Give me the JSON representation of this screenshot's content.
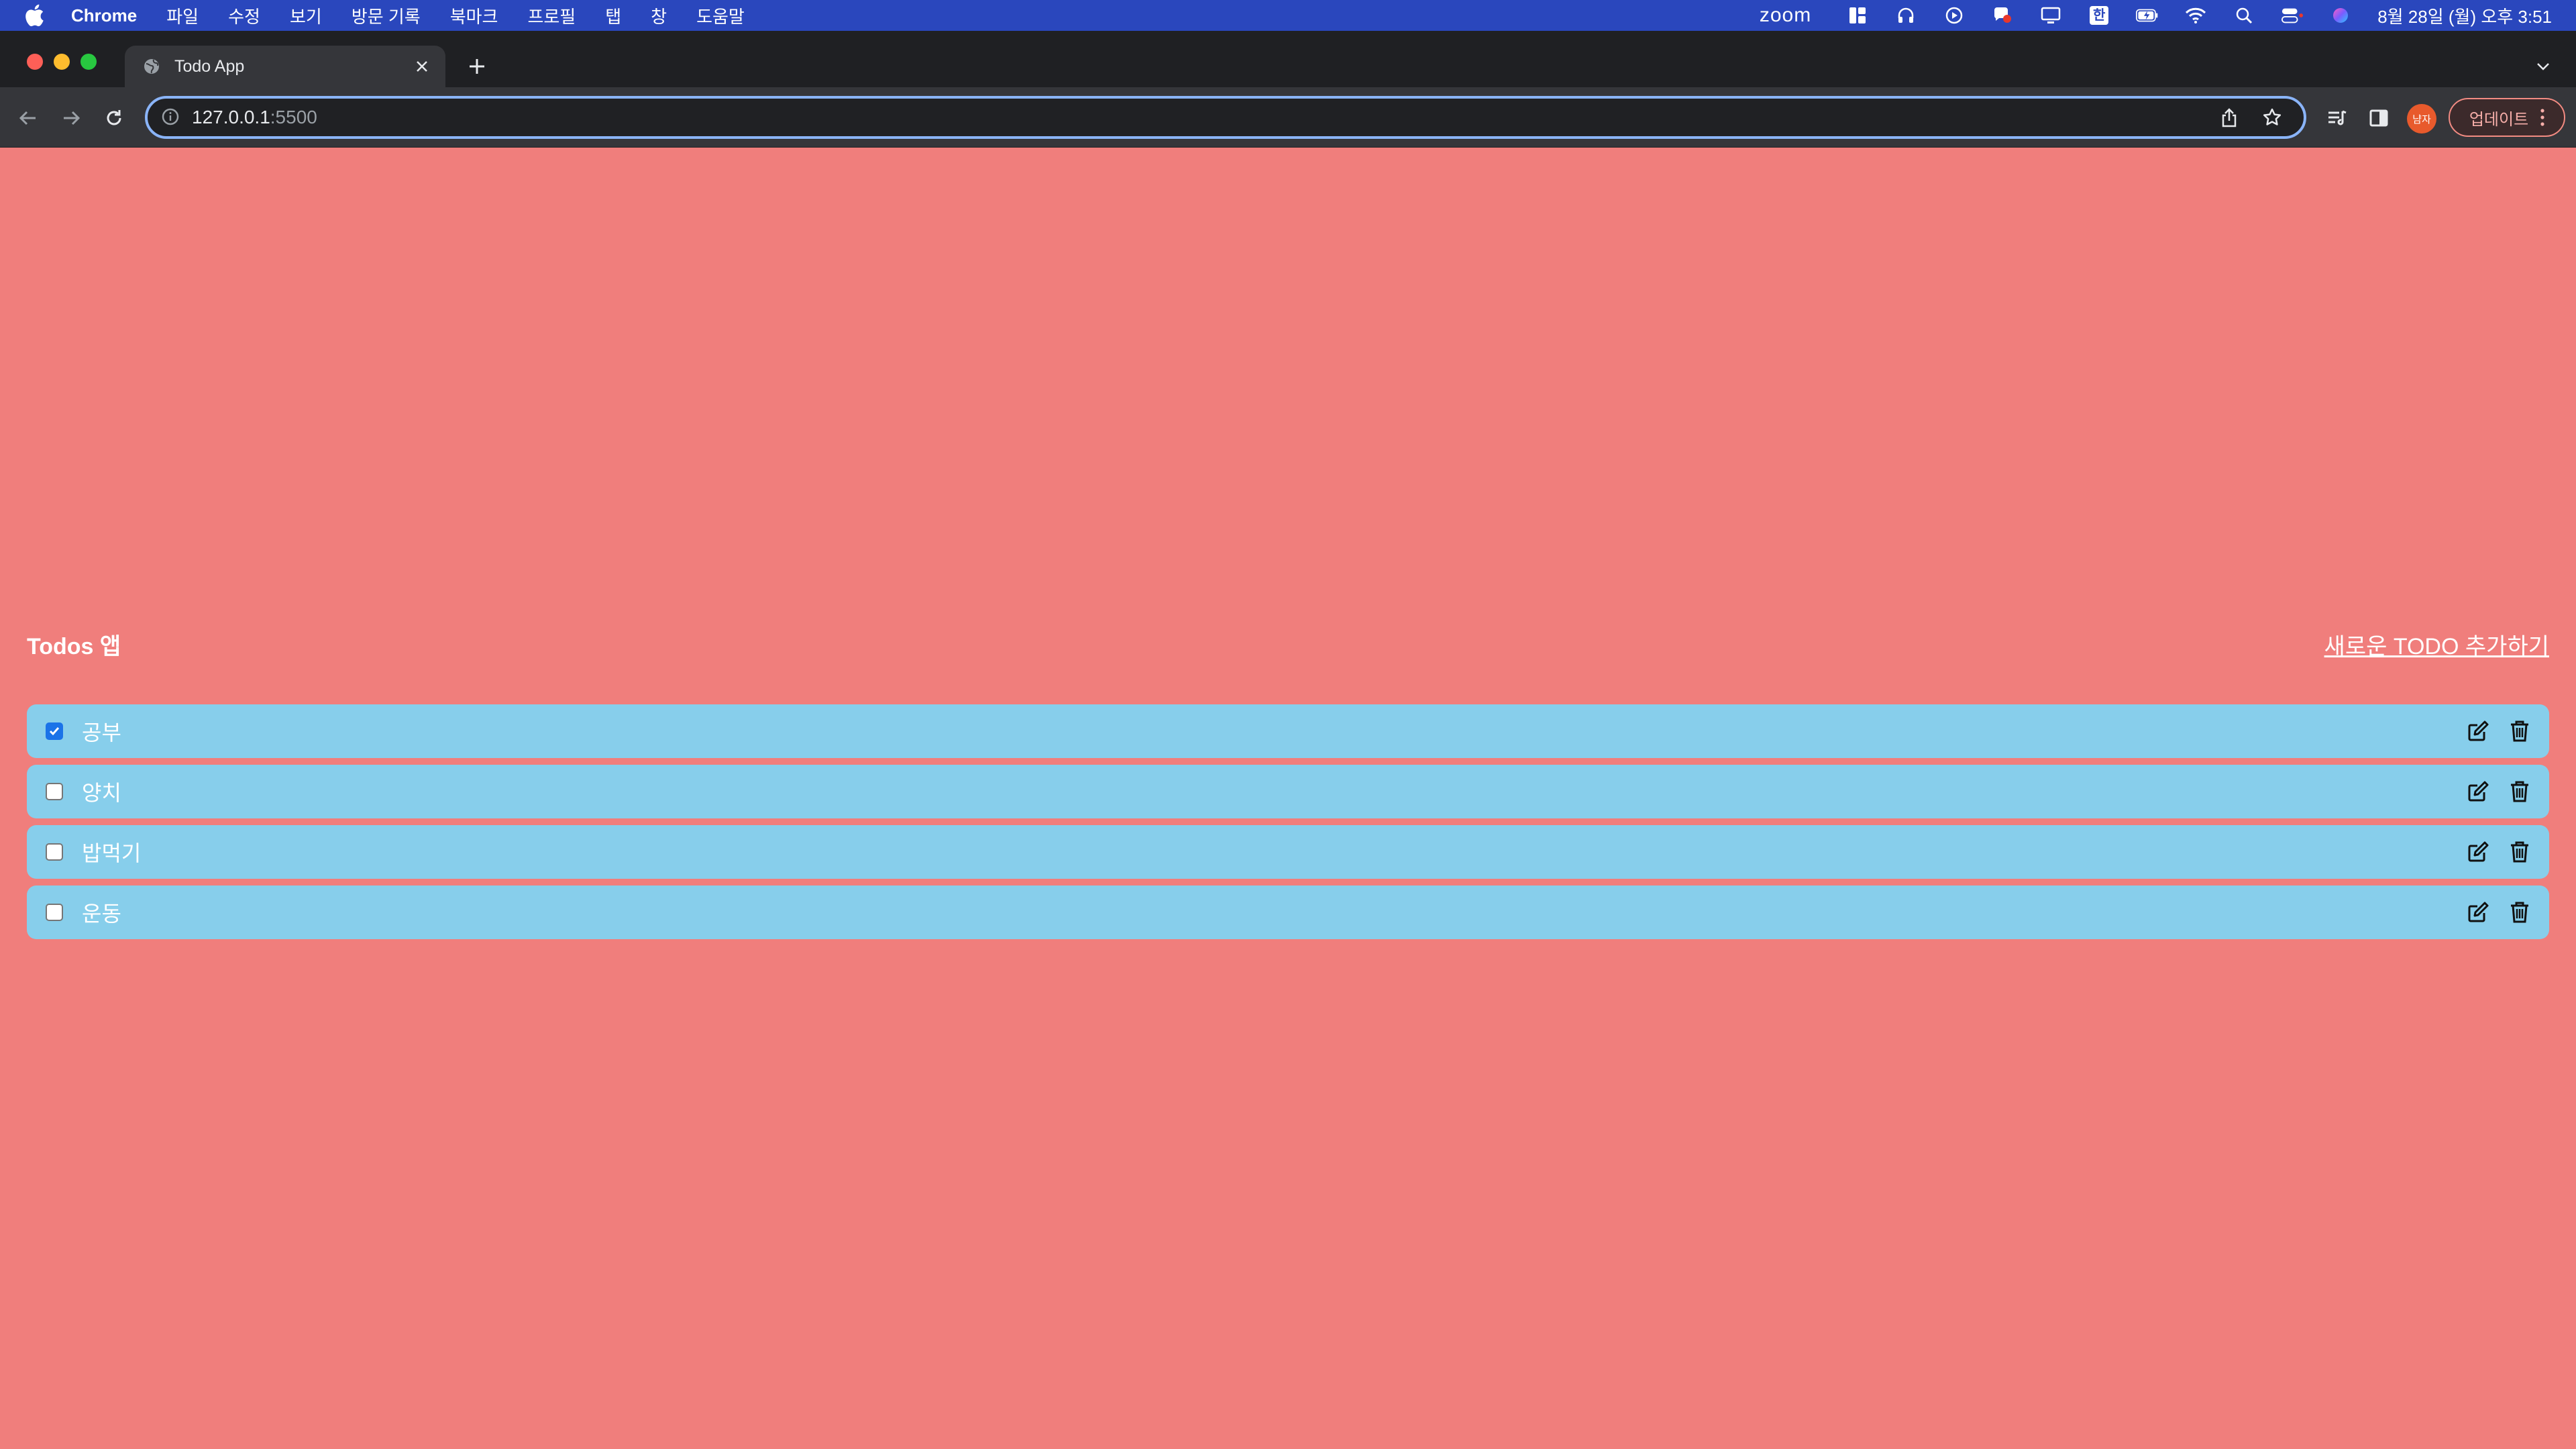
{
  "menubar": {
    "app_name": "Chrome",
    "menus": [
      "파일",
      "수정",
      "보기",
      "방문 기록",
      "북마크",
      "프로필",
      "탭",
      "창",
      "도움말"
    ],
    "zoom_label": "zoom",
    "input_method": "한",
    "clock": "8월 28일 (월) 오후 3:51"
  },
  "browser": {
    "tab_title": "Todo App",
    "url_host": "127.0.0.1",
    "url_port": ":5500",
    "profile_label": "냠자",
    "update_label": "업데이트"
  },
  "app": {
    "title": "Todos 앱",
    "add_link": "새로운 TODO 추가하기",
    "todos": [
      {
        "text": "공부",
        "done": true
      },
      {
        "text": "양치",
        "done": false
      },
      {
        "text": "밥먹기",
        "done": false
      },
      {
        "text": "운동",
        "done": false
      }
    ]
  },
  "colors": {
    "page_background": "#f07e7c",
    "todo_background": "#87ceeb",
    "menubar": "#2a47bd"
  },
  "icons": {
    "edit": "edit-icon",
    "delete": "trash-icon"
  }
}
